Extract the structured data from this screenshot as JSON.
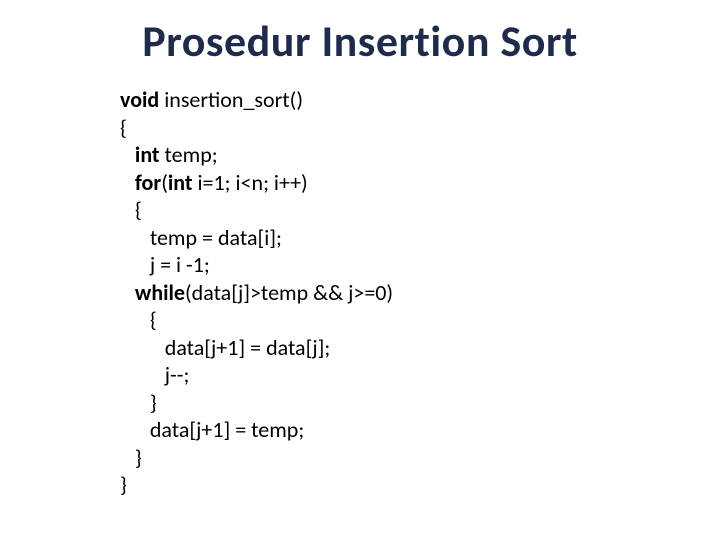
{
  "title": "Prosedur Insertion Sort",
  "code": {
    "l1_kw": "void",
    "l1_rest": " insertion_sort()",
    "l2": "{",
    "l3_kw": "int",
    "l3_rest": " temp;",
    "l4_kw1": "for",
    "l4_paren_open": "(",
    "l4_kw2": "int",
    "l4_rest": " i=1; i<n; i++)",
    "l5": "{",
    "l6": "temp = data[i];",
    "l7": "j = i -1;",
    "l8_kw": "while",
    "l8_rest": "(data[j]>temp && j>=0)",
    "l9": "{",
    "l10": "data[j+1] = data[j];",
    "l11": "j--;",
    "l12": "}",
    "l13": "data[j+1] = temp;",
    "l14": "}",
    "l15": "}"
  }
}
